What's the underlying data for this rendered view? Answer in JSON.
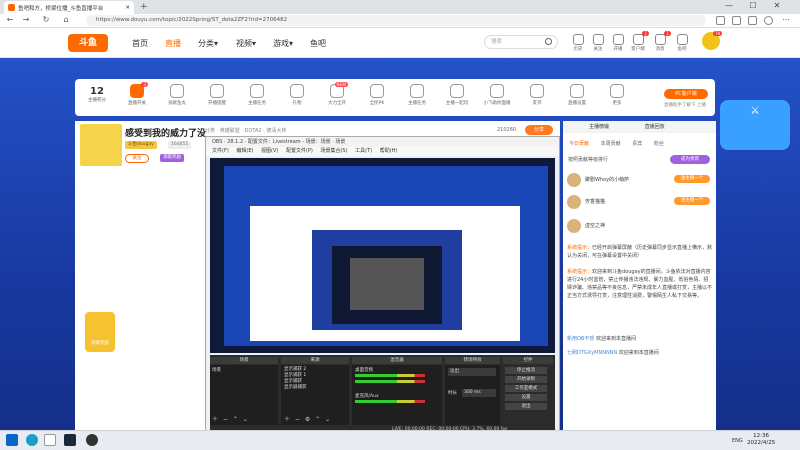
{
  "browser": {
    "tab_title": "鱼吧和方，桥梁位播_斗鱼直播平台",
    "new_tab_label": "+",
    "url": "https://www.douyu.com/topic/2022Spring/ST_dota2ZF2?rid=2706482",
    "minimize_label": "—",
    "maximize_label": "☐",
    "close_label": "✕"
  },
  "site": {
    "logo_text": "斗鱼",
    "nav": [
      "首页",
      "直播",
      "分类",
      "视频",
      "游戏",
      "鱼吧"
    ],
    "active_nav": "直播",
    "search_placeholder": "搜索",
    "header_icons": [
      {
        "label": "历史",
        "icon": "history-icon"
      },
      {
        "label": "关注",
        "icon": "follow-icon"
      },
      {
        "label": "开播",
        "icon": "broadcast-icon"
      },
      {
        "label": "客户端",
        "icon": "client-icon",
        "badge": "1"
      },
      {
        "label": "消息",
        "icon": "message-icon",
        "badge": "1"
      },
      {
        "label": "鱼吧",
        "icon": "fishbar-icon"
      }
    ],
    "avatar_badge": "78"
  },
  "tasks": {
    "today_num": "12",
    "today_label": "主播积分",
    "items": [
      {
        "label": "直播开关",
        "badge": "3"
      },
      {
        "label": "贡献鱼丸"
      },
      {
        "label": "开播提醒"
      },
      {
        "label": "主播任务"
      },
      {
        "label": "礼物"
      },
      {
        "label": "大力全开",
        "badge": "NEW"
      },
      {
        "label": "全民PK"
      },
      {
        "label": "主播任务"
      },
      {
        "label": "主播一起玩"
      },
      {
        "label": "小飞助你面播"
      },
      {
        "label": "友邻"
      },
      {
        "label": "直播设置"
      },
      {
        "label": "更多"
      }
    ],
    "pc_button": "PC客户端",
    "pc_sub": "直播助手了解下 上播"
  },
  "room": {
    "title": "感受到我的威力了没",
    "category": "分类 · 英雄联盟 · DOTA2 · 德清大林",
    "viewer_count": "210260",
    "share_label": "分享",
    "tag1": "斗鱼dougay",
    "tag2": "164855",
    "follow_label": "关注",
    "tag3": "领取奖励",
    "gift_label": "领取奖励"
  },
  "obs": {
    "title": "OBS · 28.1.2 · 配置文件：Livestream - 场景：场景 · 场景",
    "menu": [
      "文件(F)",
      "编辑(E)",
      "视图(V)",
      "配置文件(P)",
      "场景集合(S)",
      "工具(T)",
      "帮助(H)"
    ],
    "docks": [
      "场景",
      "来源",
      "混音器",
      "转场特效",
      "控件"
    ],
    "scene_item": "场景",
    "sources": [
      "显示捕获 2",
      "显示捕获 1",
      "显示捕获",
      "显示器捕获"
    ],
    "mixer": [
      "桌面音频",
      "麦克风/Aux"
    ],
    "transition": "淡出",
    "duration_label": "时长",
    "duration_value": "300 ms",
    "controls": [
      "停止推流",
      "开始录制",
      "工作室模式",
      "设置",
      "退出"
    ],
    "status": "LIVE: 00:00:00   REC: 00:00:00   CPU: 3.7%, 60.00 fps"
  },
  "chat": {
    "tabs": [
      "主播榜输",
      "直播回放"
    ],
    "subtabs": [
      "今日贡献",
      "本周贡献",
      "贵宾",
      "粉丝"
    ],
    "rank_header": "按照贡献等级排行",
    "rank_button": "成为贵宾",
    "ranks": [
      {
        "name": "聚剧Whoy的小萌萨",
        "action": "送主播一个"
      },
      {
        "name": "芳香猫猫",
        "action": "送主播一个"
      },
      {
        "name": "虚空之神",
        "action": ""
      }
    ],
    "messages": [
      {
        "sys": "系统提示：",
        "text": "已经开启弹幕屏蔽（历史弹幕同步显示直播上横示，默认为关闭，可在弹幕设置中关闭）",
        "user": ""
      },
      {
        "sys": "系统提示：",
        "text": "欢迎来到斗鱼dougay的直播间。斗鱼依法对直播内容进行24小时监管，禁止传播违法违规、暴力血腥、低俗色情、招嫖诈骗、违禁品等不良信息，严禁未成年人直播或打赏，主播以不正当方式诱导打赏，注意理性消费，警惕陌生人私下交易等。",
        "user": ""
      },
      {
        "sys": "",
        "text": "欢迎来到本直播间",
        "user": "新用OB不想"
      },
      {
        "sys": "",
        "text": "欢迎来到本直播间",
        "user": "七刷DTGXyMNNNNN"
      }
    ]
  },
  "taskbar": {
    "lang": "ENG",
    "time": "12:36",
    "date": "2022/4/25"
  },
  "colors": {
    "accent": "#ff6a00",
    "hero": "#1c3fa8",
    "purple": "#a060e0"
  }
}
